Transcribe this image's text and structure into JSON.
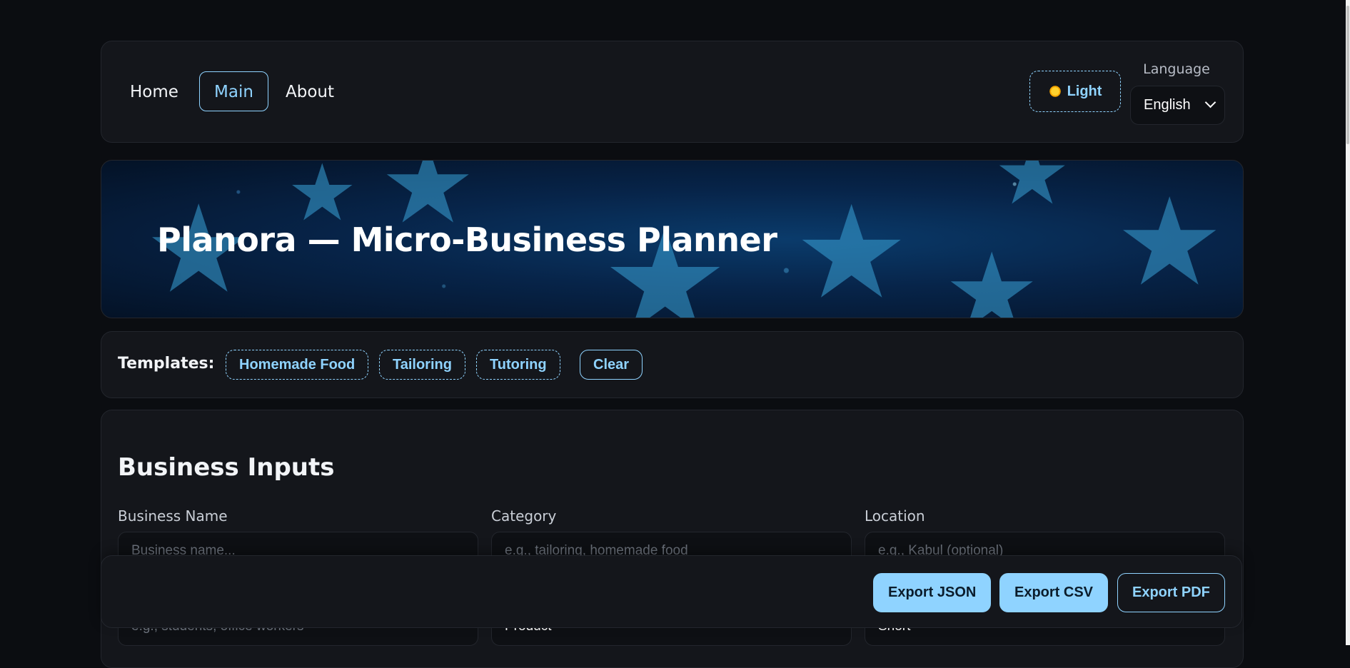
{
  "nav": {
    "links": [
      "Home",
      "Main",
      "About"
    ],
    "active": "Main",
    "theme_toggle": "Light",
    "language_label": "Language",
    "language_value": "English"
  },
  "hero": {
    "title": "Planora — Micro-Business Planner"
  },
  "templates": {
    "label": "Templates:",
    "chips": [
      "Homemade Food",
      "Tailoring",
      "Tutoring"
    ],
    "clear": "Clear"
  },
  "inputs": {
    "title": "Business Inputs",
    "fields": [
      {
        "label": "Business Name",
        "placeholder": "Business name..."
      },
      {
        "label": "Category",
        "placeholder": "e.g., tailoring, homemade food"
      },
      {
        "label": "Location",
        "placeholder": "e.g., Kabul (optional)"
      }
    ],
    "row2": [
      {
        "placeholder": "e.g., students, office workers"
      },
      {
        "value": "Product"
      },
      {
        "value": "Short"
      }
    ]
  },
  "export": {
    "json": "Export JSON",
    "csv": "Export CSV",
    "pdf": "Export PDF"
  },
  "colors": {
    "accent": "#8fd3ff",
    "background": "#0b0d11",
    "card": "#14161b"
  }
}
